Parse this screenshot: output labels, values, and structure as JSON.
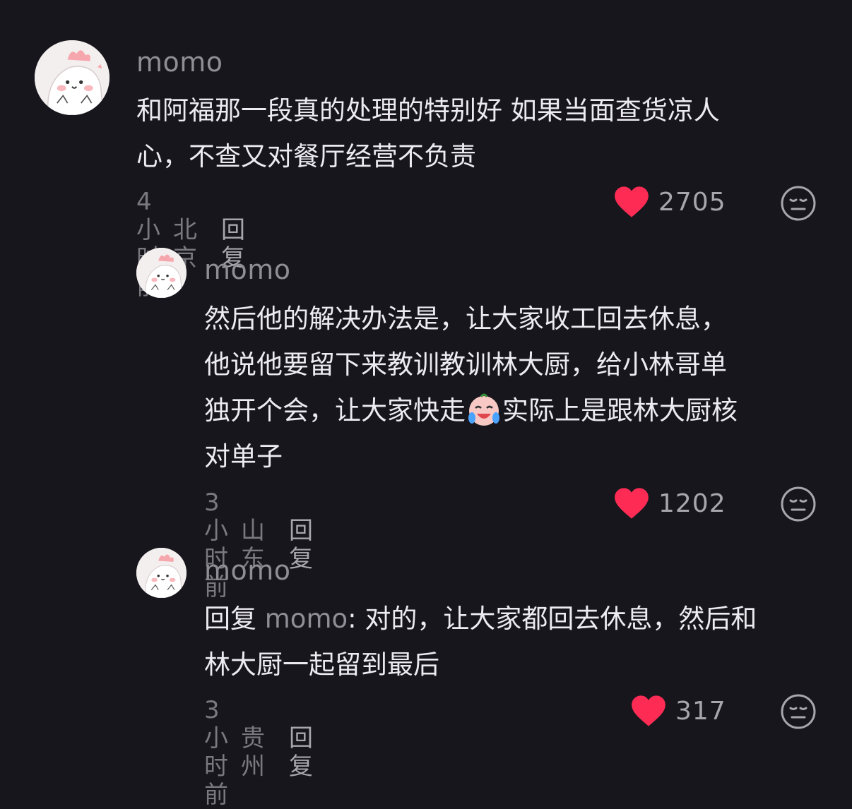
{
  "comments": [
    {
      "username": "momo",
      "text": "和阿福那一段真的处理的特别好 如果当面查货凉人\n心，不查又对餐厅经营不负责",
      "time": "4小时前",
      "location": "北京",
      "reply_label": "回复",
      "likes": "2705"
    },
    {
      "username": "momo",
      "text_before_emoji": "然后他的解决办法是，让大家收工回去休息，\n他说他要留下来教训教训林大厨，给小林哥单\n独开个会，让大家快走",
      "emoji": "crying-laughing-face",
      "text_after_emoji": "实际上是跟林大厨核\n对单子",
      "time": "3小时前",
      "location": "山东",
      "reply_label": "回复",
      "likes": "1202"
    },
    {
      "username": "momo",
      "reply_prefix": "回复 ",
      "reply_target": "momo",
      "text": ": 对的，让大家都回去休息，然后和\n林大厨一起留到最后",
      "time": "3小时前",
      "location": "贵州",
      "reply_label": "回复",
      "likes": "317"
    }
  ],
  "icons": {
    "like": "heart-icon",
    "dislike": "dislike-face-icon",
    "avatar": "pink-cartoon-avatar"
  },
  "colors": {
    "background": "#17161c",
    "heart": "#fe2c55",
    "muted": "#7a7980"
  }
}
